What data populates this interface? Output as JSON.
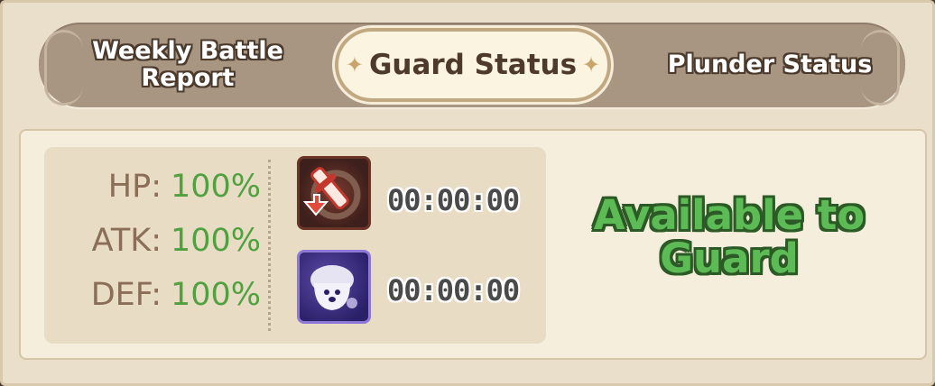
{
  "tabs": {
    "weekly_battle_report": "Weekly Battle\nReport",
    "guard_status": "Guard Status",
    "plunder_status": "Plunder Status",
    "active_tab": "guard_status"
  },
  "stats": [
    {
      "label": "HP:",
      "value": "100%"
    },
    {
      "label": "ATK:",
      "value": "100%"
    },
    {
      "label": "DEF:",
      "value": "100%"
    }
  ],
  "buffs": [
    {
      "icon": "sword-shield-debuff-icon",
      "timer": "00:00:00"
    },
    {
      "icon": "ghost-buff-icon",
      "timer": "00:00:00"
    }
  ],
  "status": "Available to\nGuard",
  "colors": {
    "stat_value": "#4fa23f",
    "status_text": "#5dbb55",
    "tab_bar": "#a89683",
    "active_tab_bg": "#fbf4e0"
  }
}
